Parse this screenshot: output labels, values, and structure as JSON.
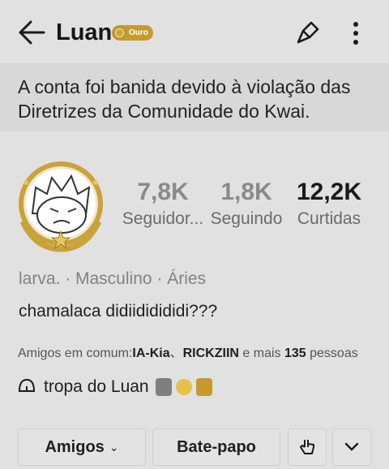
{
  "header": {
    "title": "Luan",
    "badge_label": "Ouro",
    "icons": [
      "back-arrow-icon",
      "share-icon",
      "more-vertical-icon"
    ]
  },
  "notice": {
    "text": "A conta foi banida devido à violação das Diretrizes da Comunidade do Kwai."
  },
  "stats": [
    {
      "value": "7,8K",
      "label": "Seguidor..."
    },
    {
      "value": "1,8K",
      "label": "Seguindo"
    },
    {
      "value": "12,2K",
      "label": "Curtidas"
    }
  ],
  "profile": {
    "info": "larva. · Masculino · Áries",
    "bio": "chamalaca didiididididi???"
  },
  "friends": {
    "prefix": "Amigos em comum:",
    "name1": "IA-Kia",
    "sep": "、",
    "name2": "RICKZIIN",
    "mid": " e mais ",
    "count": "135",
    "suffix": " pessoas"
  },
  "group": {
    "name": "tropa do Luan",
    "emojis": [
      "moai",
      "face",
      "trophy"
    ]
  },
  "actions": {
    "friends_label": "Amigos",
    "chat_label": "Bate-papo"
  }
}
